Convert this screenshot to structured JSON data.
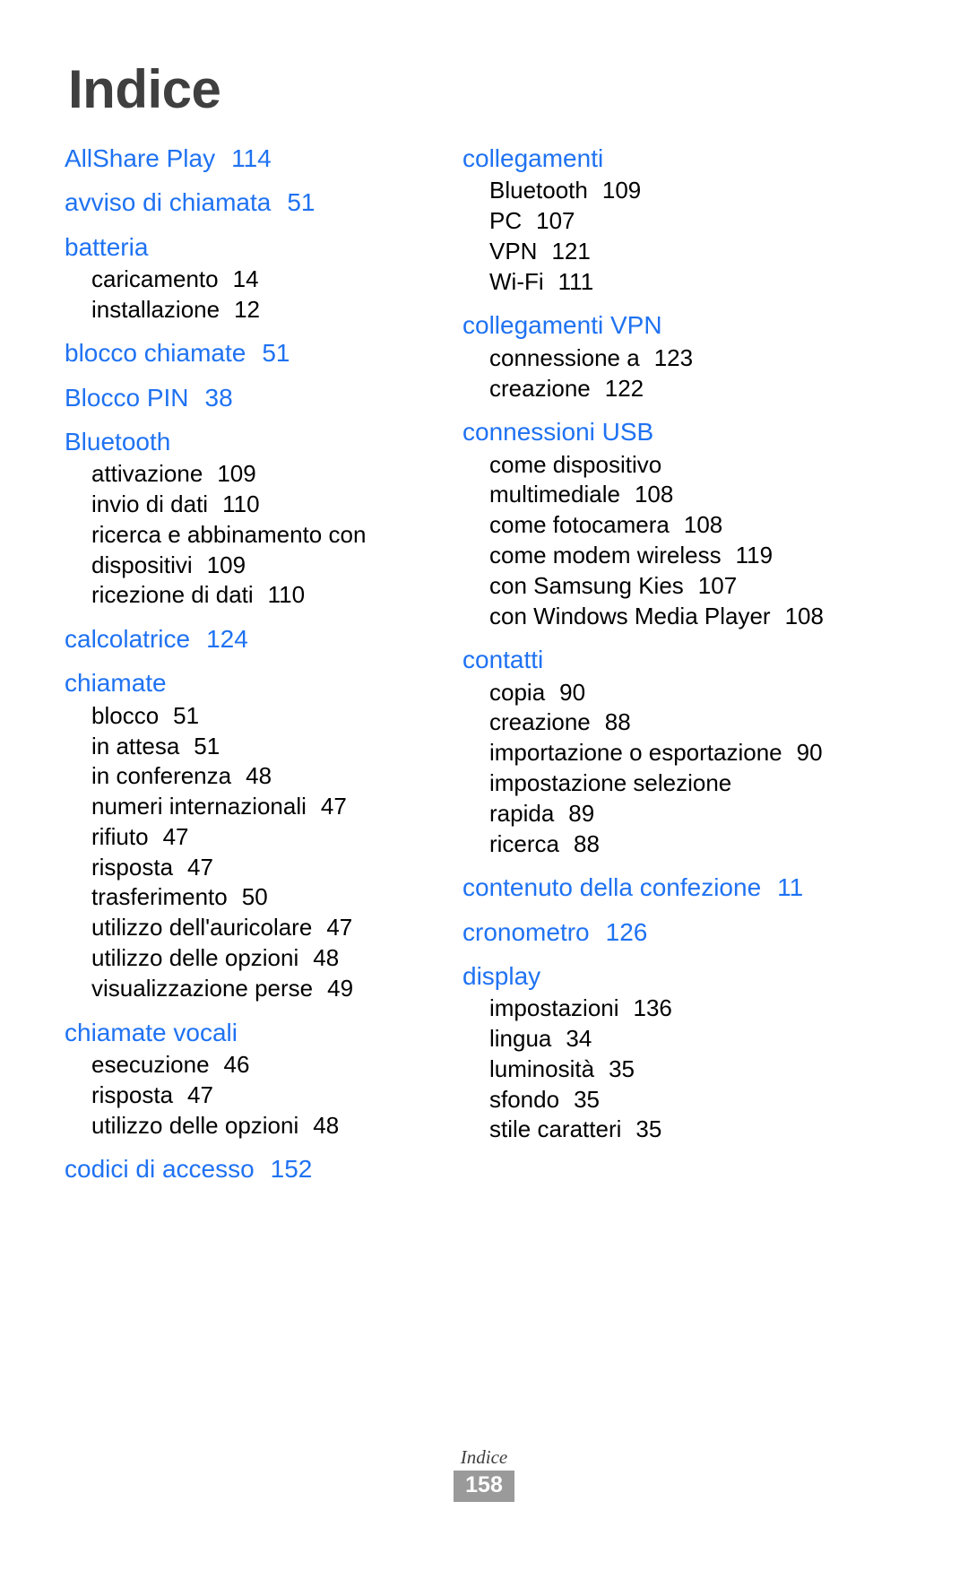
{
  "title": "Indice",
  "colors": {
    "heading_blue": "#1f72f2",
    "title_gray": "#3f3f3f",
    "badge_gray": "#9a9a9a"
  },
  "columns": [
    {
      "name": "left-column",
      "groups": [
        {
          "head": "AllShare Play",
          "page": "114",
          "subs": []
        },
        {
          "head": "avviso di chiamata",
          "page": "51",
          "subs": []
        },
        {
          "head": "batteria",
          "page": "",
          "subs": [
            {
              "label": "caricamento",
              "page": "14"
            },
            {
              "label": "installazione",
              "page": "12"
            }
          ]
        },
        {
          "head": "blocco chiamate",
          "page": "51",
          "subs": []
        },
        {
          "head": "Blocco PIN",
          "page": "38",
          "subs": []
        },
        {
          "head": "Bluetooth",
          "page": "",
          "subs": [
            {
              "label": "attivazione",
              "page": "109"
            },
            {
              "label": "invio di dati",
              "page": "110"
            },
            {
              "label": "ricerca e abbinamento con dispositivi",
              "page": "109",
              "wrap": true
            },
            {
              "label": "ricezione di dati",
              "page": "110"
            }
          ]
        },
        {
          "head": "calcolatrice",
          "page": "124",
          "subs": []
        },
        {
          "head": "chiamate",
          "page": "",
          "subs": [
            {
              "label": "blocco",
              "page": "51"
            },
            {
              "label": "in attesa",
              "page": "51"
            },
            {
              "label": "in conferenza",
              "page": "48"
            },
            {
              "label": "numeri internazionali",
              "page": "47"
            },
            {
              "label": "rifiuto",
              "page": "47"
            },
            {
              "label": "risposta",
              "page": "47"
            },
            {
              "label": "trasferimento",
              "page": "50"
            },
            {
              "label": "utilizzo dell'auricolare",
              "page": "47"
            },
            {
              "label": "utilizzo delle opzioni",
              "page": "48"
            },
            {
              "label": "visualizzazione perse",
              "page": "49"
            }
          ]
        },
        {
          "head": "chiamate vocali",
          "page": "",
          "subs": [
            {
              "label": "esecuzione",
              "page": "46"
            },
            {
              "label": "risposta",
              "page": "47"
            },
            {
              "label": "utilizzo delle opzioni",
              "page": "48"
            }
          ]
        },
        {
          "head": "codici di accesso",
          "page": "152",
          "subs": []
        }
      ]
    },
    {
      "name": "right-column",
      "groups": [
        {
          "head": "collegamenti",
          "page": "",
          "subs": [
            {
              "label": "Bluetooth",
              "page": "109"
            },
            {
              "label": "PC",
              "page": "107"
            },
            {
              "label": "VPN",
              "page": "121"
            },
            {
              "label": "Wi-Fi",
              "page": "111"
            }
          ]
        },
        {
          "head": "collegamenti VPN",
          "page": "",
          "subs": [
            {
              "label": "connessione a",
              "page": "123"
            },
            {
              "label": "creazione",
              "page": "122"
            }
          ]
        },
        {
          "head": "connessioni USB",
          "page": "",
          "subs": [
            {
              "label": "come dispositivo multimediale",
              "page": "108",
              "wrap": true
            },
            {
              "label": "come fotocamera",
              "page": "108"
            },
            {
              "label": "come modem wireless",
              "page": "119"
            },
            {
              "label": "con Samsung Kies",
              "page": "107"
            },
            {
              "label": "con Windows Media Player",
              "page": "108",
              "wrap": true
            }
          ]
        },
        {
          "head": "contatti",
          "page": "",
          "subs": [
            {
              "label": "copia",
              "page": "90"
            },
            {
              "label": "creazione",
              "page": "88"
            },
            {
              "label": "importazione o esportazione",
              "page": "90",
              "wrap": true
            },
            {
              "label": "impostazione selezione rapida",
              "page": "89",
              "wrap": true
            },
            {
              "label": "ricerca",
              "page": "88"
            }
          ]
        },
        {
          "head": "contenuto della confezione",
          "page": "11",
          "wrap": true,
          "subs": []
        },
        {
          "head": "cronometro",
          "page": "126",
          "subs": []
        },
        {
          "head": "display",
          "page": "",
          "subs": [
            {
              "label": "impostazioni",
              "page": "136"
            },
            {
              "label": "lingua",
              "page": "34"
            },
            {
              "label": "luminosità",
              "page": "35"
            },
            {
              "label": "sfondo",
              "page": "35"
            },
            {
              "label": "stile caratteri",
              "page": "35"
            }
          ]
        }
      ]
    }
  ],
  "footer": {
    "label": "Indice",
    "page_number": "158"
  }
}
